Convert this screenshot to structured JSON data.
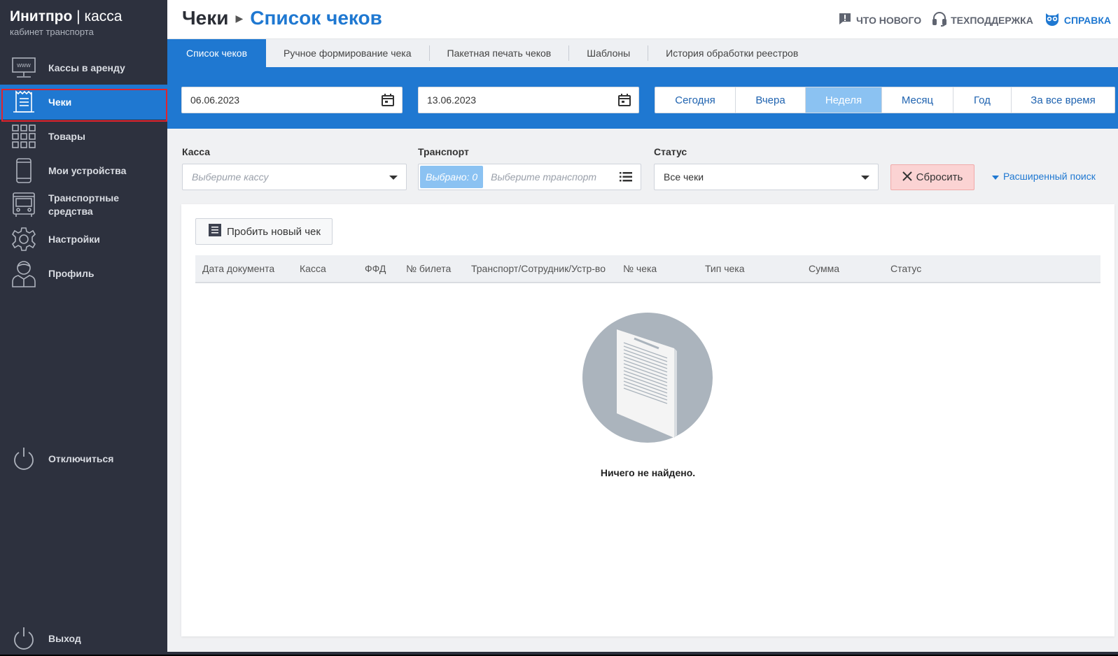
{
  "brand": {
    "name_bold": "Инитпро",
    "name_rest": "касса",
    "subtitle": "кабинет транспорта"
  },
  "sidebar": {
    "items": [
      {
        "label": "Кассы в аренду",
        "icon": "www-monitor-icon"
      },
      {
        "label": "Чеки",
        "icon": "receipt-icon",
        "active": true
      },
      {
        "label": "Товары",
        "icon": "grid-icon"
      },
      {
        "label": "Мои устройства",
        "icon": "phone-icon"
      },
      {
        "label": "Транспортные средства",
        "icon": "bus-icon"
      },
      {
        "label": "Настройки",
        "icon": "gear-icon"
      },
      {
        "label": "Профиль",
        "icon": "user-icon"
      }
    ],
    "disconnect_label": "Отключиться",
    "logout_label": "Выход"
  },
  "header": {
    "breadcrumb_parent": "Чеки",
    "breadcrumb_current": "Список чеков",
    "links": {
      "whats_new": "ЧТО НОВОГО",
      "support": "ТЕХПОДДЕРЖКА",
      "help": "СПРАВКА"
    }
  },
  "tabs": [
    {
      "label": "Список чеков",
      "active": true
    },
    {
      "label": "Ручное формирование чека"
    },
    {
      "label": "Пакетная печать чеков"
    },
    {
      "label": "Шаблоны"
    },
    {
      "label": "История обработки реестров"
    }
  ],
  "dates": {
    "from": "06.06.2023",
    "to": "13.06.2023"
  },
  "periods": [
    {
      "label": "Сегодня"
    },
    {
      "label": "Вчера"
    },
    {
      "label": "Неделя",
      "active": true
    },
    {
      "label": "Месяц"
    },
    {
      "label": "Год"
    },
    {
      "label": "За все время"
    }
  ],
  "filters": {
    "kassa": {
      "label": "Касса",
      "placeholder": "Выберите кассу"
    },
    "transport": {
      "label": "Транспорт",
      "chip": "Выбрано: 0",
      "placeholder": "Выберите транспорт"
    },
    "status": {
      "label": "Статус",
      "value": "Все чеки"
    },
    "reset_label": "Сбросить",
    "advanced_label": "Расширенный поиск"
  },
  "content": {
    "new_receipt_label": "Пробить новый чек",
    "columns": [
      "Дата документа",
      "Касса",
      "ФФД",
      "№ билета",
      "Транспорт/Сотрудник/Устр-во",
      "№ чека",
      "Тип чека",
      "Сумма",
      "Статус"
    ],
    "empty_text": "Ничего не найдено."
  },
  "colors": {
    "accent": "#1f78d1",
    "sidebar_bg": "#2d313e",
    "active_period": "#8bc2f2",
    "reset_bg": "#fbd3d3",
    "highlight_outline": "#e0232e"
  }
}
